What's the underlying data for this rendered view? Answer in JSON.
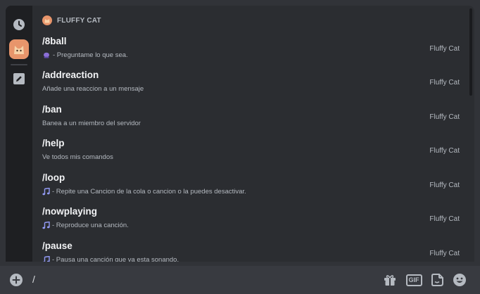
{
  "bot": {
    "name": "FLUFFY CAT"
  },
  "commands": [
    {
      "name": "/8ball",
      "description": "- Preguntame lo que sea.",
      "icon": "crystal-ball-icon",
      "source": "Fluffy Cat"
    },
    {
      "name": "/addreaction",
      "description": "Añade una reaccion a un mensaje",
      "icon": "",
      "source": "Fluffy Cat"
    },
    {
      "name": "/ban",
      "description": "Banea a un miembro del servidor",
      "icon": "",
      "source": "Fluffy Cat"
    },
    {
      "name": "/help",
      "description": "Ve todos mis comandos",
      "icon": "",
      "source": "Fluffy Cat"
    },
    {
      "name": "/loop",
      "description": "- Repite una Cancion de la cola o cancion o la puedes desactivar.",
      "icon": "music-note-icon",
      "source": "Fluffy Cat"
    },
    {
      "name": "/nowplaying",
      "description": "- Reproduce una canción.",
      "icon": "music-note-icon",
      "source": "Fluffy Cat"
    },
    {
      "name": "/pause",
      "description": "- Pausa una canción que va esta sonando.",
      "icon": "music-note-icon",
      "source": "Fluffy Cat"
    }
  ],
  "input": {
    "value": "/"
  },
  "colors": {
    "accent": "#949cf7",
    "icon": "#b5bac1",
    "avatar": "#e8956b"
  }
}
